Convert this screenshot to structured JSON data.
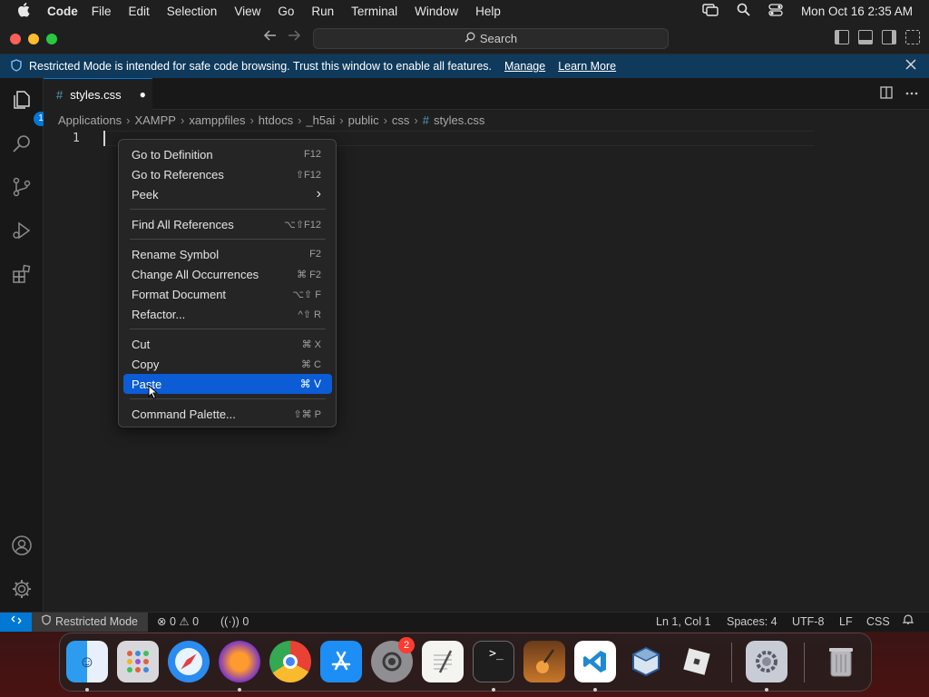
{
  "menubar": {
    "app_name": "Code",
    "menus": [
      "File",
      "Edit",
      "Selection",
      "View",
      "Go",
      "Run",
      "Terminal",
      "Window",
      "Help"
    ],
    "clock": "Mon Oct 16  2:35 AM"
  },
  "titlebar": {
    "search_label": "Search"
  },
  "banner": {
    "message": "Restricted Mode is intended for safe code browsing. Trust this window to enable all features.",
    "manage_link": "Manage",
    "learn_more_link": "Learn More"
  },
  "activitybar": {
    "explorer_badge": "1"
  },
  "tab": {
    "icon": "#",
    "filename": "styles.css",
    "modified_dot": "●"
  },
  "breadcrumb": {
    "items": [
      "Applications",
      "XAMPP",
      "xamppfiles",
      "htdocs",
      "_h5ai",
      "public",
      "css"
    ],
    "file_icon": "#",
    "file": "styles.css"
  },
  "editor": {
    "line_number": "1"
  },
  "context_menu": {
    "items": [
      {
        "label": "Go to Definition",
        "shortcut": "F12"
      },
      {
        "label": "Go to References",
        "shortcut": "⇧F12"
      },
      {
        "label": "Peek",
        "shortcut": "›"
      },
      {
        "label": "Find All References",
        "shortcut": "⌥⇧F12"
      },
      {
        "label": "Rename Symbol",
        "shortcut": "F2"
      },
      {
        "label": "Change All Occurrences",
        "shortcut": "⌘ F2"
      },
      {
        "label": "Format Document",
        "shortcut": "⌥⇧ F"
      },
      {
        "label": "Refactor...",
        "shortcut": "^⇧ R"
      },
      {
        "label": "Cut",
        "shortcut": "⌘ X"
      },
      {
        "label": "Copy",
        "shortcut": "⌘ C"
      },
      {
        "label": "Paste",
        "shortcut": "⌘ V"
      },
      {
        "label": "Command Palette...",
        "shortcut": "⇧⌘ P"
      }
    ],
    "highlighted_item": "Paste"
  },
  "statusbar": {
    "restricted_mode": "Restricted Mode",
    "errors": "0",
    "warnings": "0",
    "ports": "0",
    "cursor_position": "Ln 1, Col 1",
    "indentation": "Spaces: 4",
    "encoding": "UTF-8",
    "line_ending": "LF",
    "language": "CSS"
  },
  "dock": {
    "apps": [
      "Finder",
      "Launchpad",
      "Safari",
      "Firefox",
      "Chrome",
      "App Store",
      "System Settings",
      "TextEdit",
      "Terminal",
      "GarageBand",
      "Visual Studio Code",
      "VirtualBox",
      "Roblox",
      "System Settings 2",
      "Trash"
    ],
    "settings_badge": "2"
  },
  "colors": {
    "accent": "#0078d4",
    "banner_bg": "#0f3a5c",
    "menu_highlight": "#0b5cd5"
  }
}
